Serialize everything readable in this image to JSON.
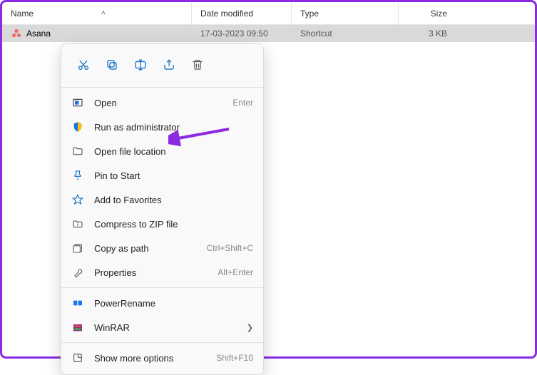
{
  "headers": {
    "name": "Name",
    "date": "Date modified",
    "type": "Type",
    "size": "Size"
  },
  "file": {
    "name": "Asana",
    "date": "17-03-2023 09:50",
    "type": "Shortcut",
    "size": "3 KB"
  },
  "menu": {
    "open": {
      "label": "Open",
      "shortcut": "Enter"
    },
    "runAdmin": {
      "label": "Run as administrator"
    },
    "openLocation": {
      "label": "Open file location"
    },
    "pinStart": {
      "label": "Pin to Start"
    },
    "addFavorites": {
      "label": "Add to Favorites"
    },
    "compressZip": {
      "label": "Compress to ZIP file"
    },
    "copyPath": {
      "label": "Copy as path",
      "shortcut": "Ctrl+Shift+C"
    },
    "properties": {
      "label": "Properties",
      "shortcut": "Alt+Enter"
    },
    "powerRename": {
      "label": "PowerRename"
    },
    "winrar": {
      "label": "WinRAR"
    },
    "showMore": {
      "label": "Show more options",
      "shortcut": "Shift+F10"
    }
  }
}
